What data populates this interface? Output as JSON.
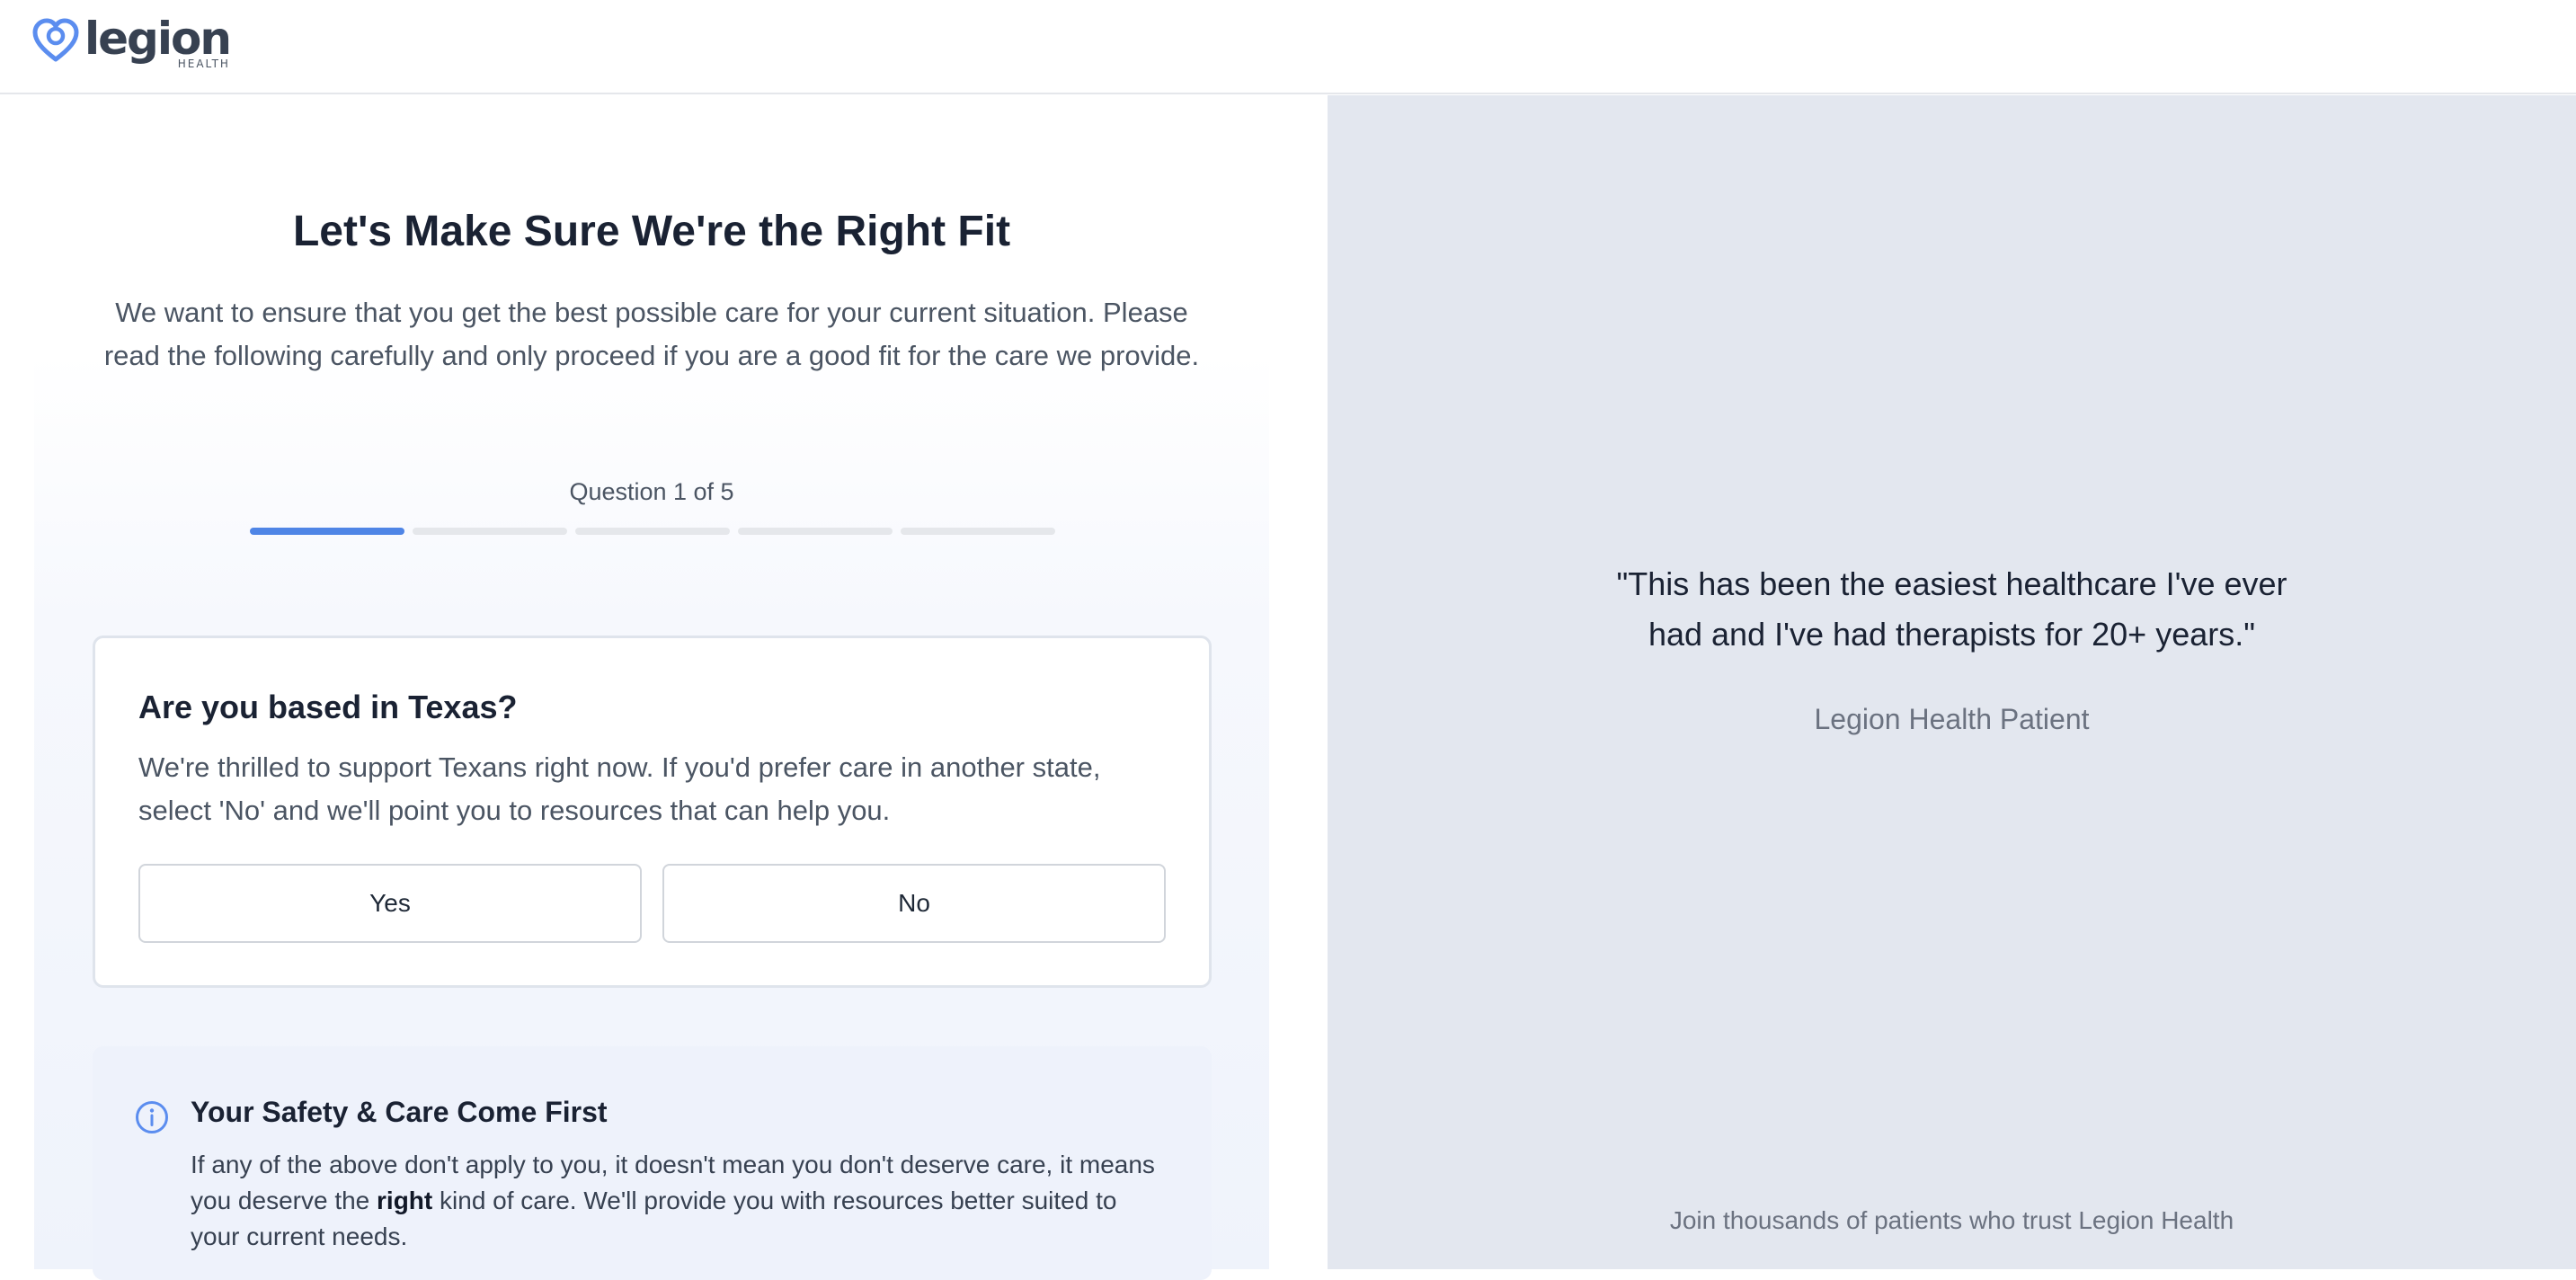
{
  "header": {
    "logo_word": "legion",
    "logo_sub": "HEALTH",
    "logo_icon": "heart-logo-icon"
  },
  "main": {
    "title": "Let's Make Sure We're the Right Fit",
    "intro": "We want to ensure that you get the best possible care for your current situation. Please read the following carefully and only proceed if you are a good fit for the care we provide.",
    "progress": {
      "label": "Question 1 of 5",
      "current": 1,
      "total": 5
    },
    "question": {
      "title": "Are you based in Texas?",
      "description": "We're thrilled to support Texans right now. If you'd prefer care in another state, select 'No' and we'll point you to resources that can help you.",
      "options": [
        "Yes",
        "No"
      ]
    },
    "safety": {
      "icon": "info-icon",
      "title": "Your Safety & Care Come First",
      "body_before": "If any of the above don't apply to you, it doesn't mean you don't deserve care, it means you deserve the ",
      "body_bold": "right",
      "body_after": " kind of care. We'll provide you with resources better suited to your current needs."
    }
  },
  "sidebar": {
    "quote": "\"This has been the easiest healthcare I've ever had and I've had therapists for 20+ years.\"",
    "attribution": "Legion Health Patient",
    "trust_line": "Join thousands of patients who trust Legion Health"
  },
  "colors": {
    "accent": "#4f85e6",
    "right_panel_bg": "#e3e7ef",
    "heading": "#1a2233"
  }
}
